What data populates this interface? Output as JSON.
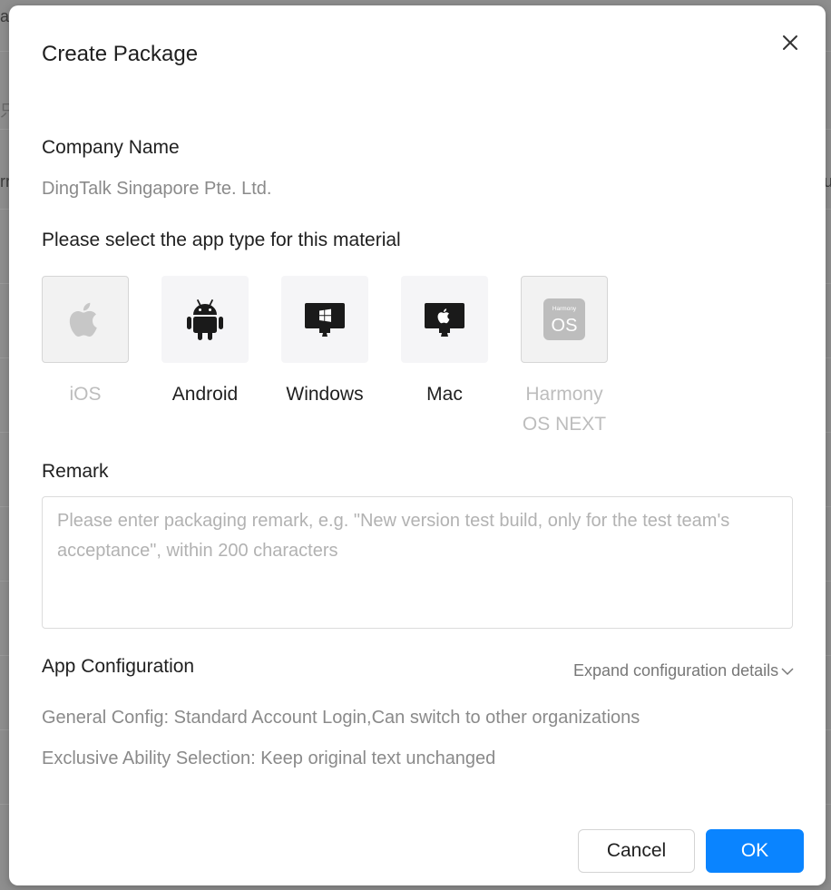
{
  "dialog": {
    "title": "Create Package",
    "company": {
      "label": "Company Name",
      "value": "DingTalk Singapore Pte. Ltd."
    },
    "app_type": {
      "label": "Please select the app type for this material",
      "options": [
        {
          "name": "iOS",
          "icon": "apple-icon",
          "enabled": false
        },
        {
          "name": "Android",
          "icon": "android-icon",
          "enabled": true
        },
        {
          "name": "Windows",
          "icon": "windows-icon",
          "enabled": true
        },
        {
          "name": "Mac",
          "icon": "mac-icon",
          "enabled": true
        },
        {
          "name_line1": "Harmony",
          "name_line2": "OS NEXT",
          "icon": "harmony-os-icon",
          "icon_text_top": "Harmony",
          "icon_text_main": "OS",
          "enabled": false
        }
      ]
    },
    "remark": {
      "label": "Remark",
      "placeholder": "Please enter packaging remark, e.g. \"New version test build, only for the test team's acceptance\", within 200 characters"
    },
    "app_config": {
      "label": "App Configuration",
      "expand_link": "Expand configuration details",
      "general_config": "General Config: Standard Account Login,Can switch to other organizations",
      "exclusive_ability": "Exclusive Ability Selection: Keep original text unchanged"
    },
    "buttons": {
      "cancel": "Cancel",
      "ok": "OK"
    }
  },
  "background": {
    "fragments": [
      "ag",
      "只",
      "rr",
      "u"
    ]
  },
  "colors": {
    "primary": "#0a84ff",
    "text": "#1f1f1f",
    "muted": "#8a8a8a",
    "disabled": "#bdbdbd"
  }
}
